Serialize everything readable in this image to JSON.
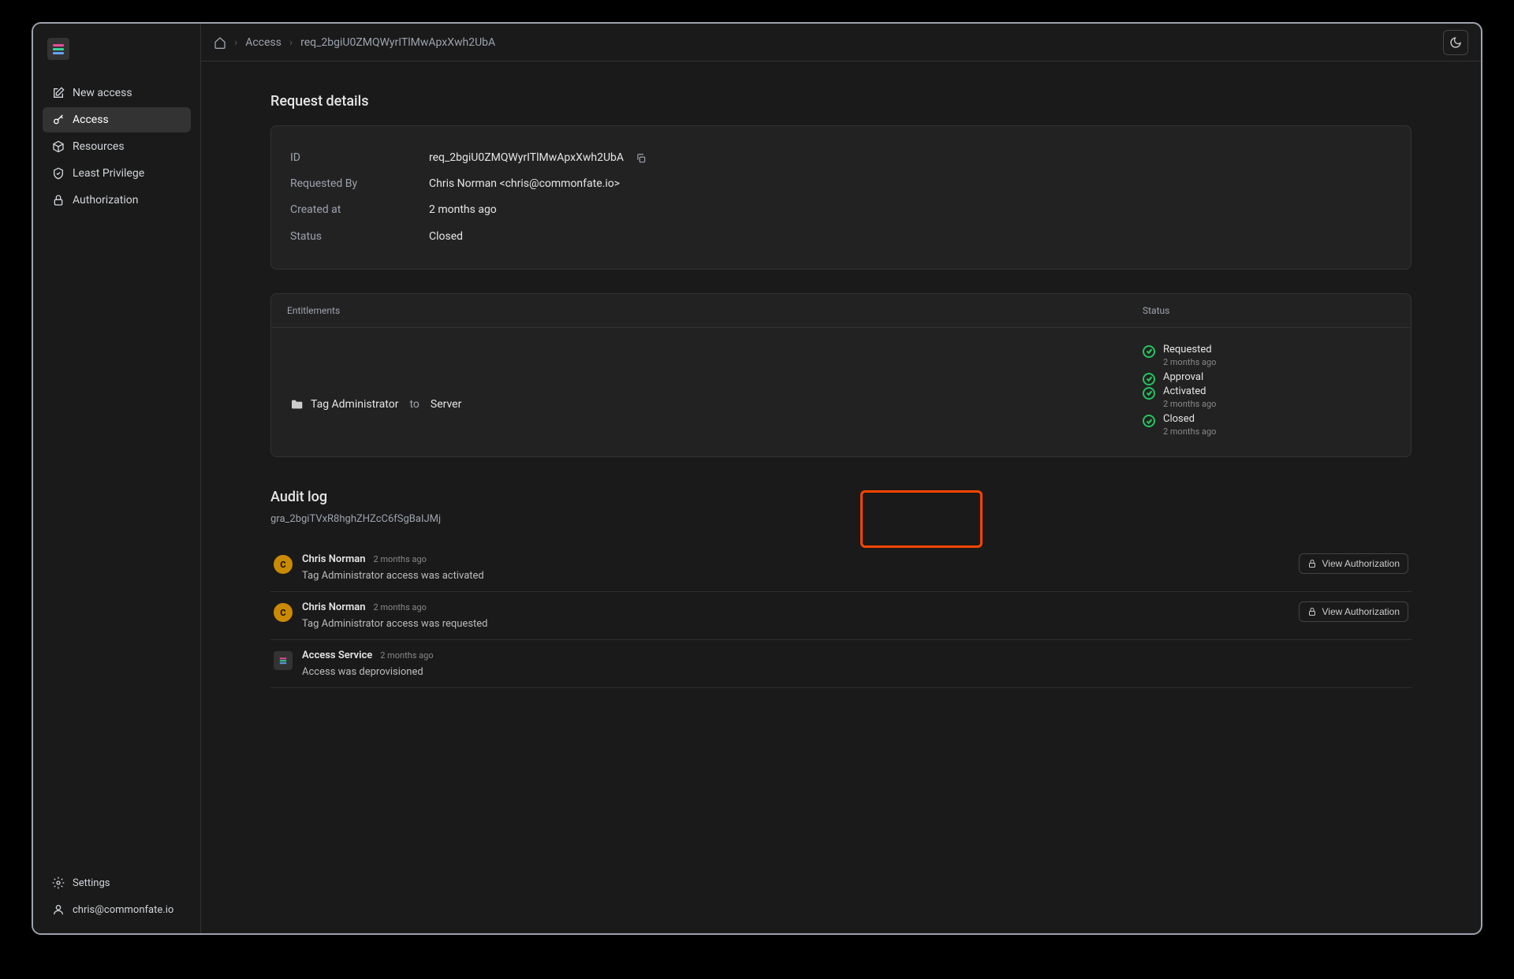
{
  "sidebar": {
    "items": [
      {
        "label": "New access",
        "icon": "edit"
      },
      {
        "label": "Access",
        "icon": "key",
        "active": true
      },
      {
        "label": "Resources",
        "icon": "cube"
      },
      {
        "label": "Least Privilege",
        "icon": "shield"
      },
      {
        "label": "Authorization",
        "icon": "lock"
      }
    ],
    "settings_label": "Settings",
    "user_email": "chris@commonfate.io"
  },
  "breadcrumbs": {
    "item1": "Access",
    "item2": "req_2bgiU0ZMQWyrITlMwApxXwh2UbA"
  },
  "page": {
    "section_title": "Request details",
    "fields": {
      "id_label": "ID",
      "id_value": "req_2bgiU0ZMQWyrITlMwApxXwh2UbA",
      "requested_by_label": "Requested By",
      "requested_by_value": "Chris Norman <chris@commonfate.io>",
      "created_at_label": "Created at",
      "created_at_value": "2 months ago",
      "status_label": "Status",
      "status_value": "Closed"
    },
    "entitlements": {
      "header_left": "Entitlements",
      "header_right": "Status",
      "role": "Tag Administrator",
      "to": "to",
      "resource": "Server",
      "statuses": [
        {
          "label": "Requested",
          "time": "2 months ago"
        },
        {
          "label": "Approval",
          "time": ""
        },
        {
          "label": "Activated",
          "time": "2 months ago"
        },
        {
          "label": "Closed",
          "time": "2 months ago"
        }
      ]
    },
    "audit": {
      "title": "Audit log",
      "id": "gra_2bgiTVxR8hghZHZcC6fSgBaIJMj",
      "view_auth_label": "View Authorization",
      "entries": [
        {
          "actor": "Chris Norman",
          "time": "2 months ago",
          "msg": "Tag Administrator access was activated",
          "avatar": "C",
          "has_auth": true,
          "highlight": true
        },
        {
          "actor": "Chris Norman",
          "time": "2 months ago",
          "msg": "Tag Administrator access was requested",
          "avatar": "C",
          "has_auth": true
        },
        {
          "actor": "Access Service",
          "time": "2 months ago",
          "msg": "Access was deprovisioned",
          "avatar": "svc",
          "has_auth": false
        }
      ]
    }
  }
}
